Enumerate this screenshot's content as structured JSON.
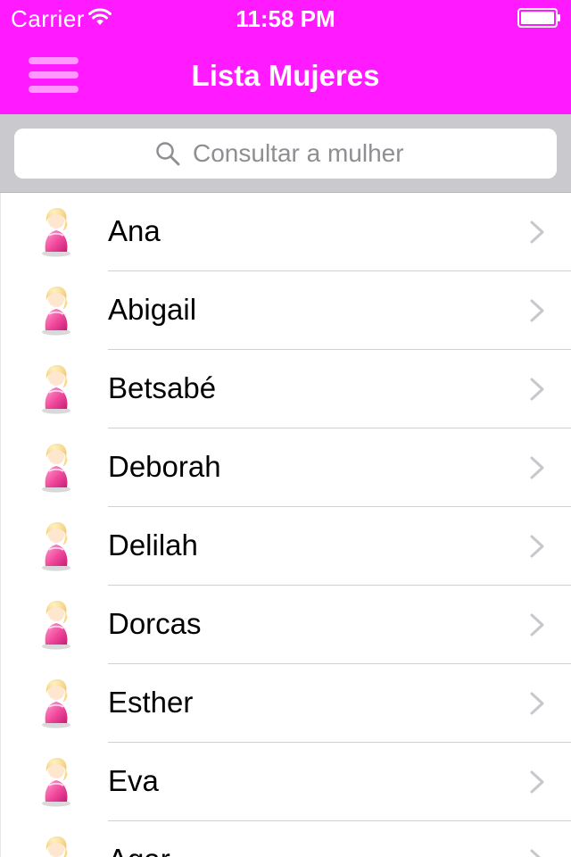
{
  "status_bar": {
    "carrier": "Carrier",
    "time": "11:58 PM",
    "wifi_icon": "wifi-icon",
    "battery_icon": "battery-icon"
  },
  "nav": {
    "title": "Lista Mujeres",
    "menu_icon": "hamburger-menu-icon",
    "background_color": "#ff1aff"
  },
  "search": {
    "placeholder": "Consultar a mulher",
    "value": "",
    "icon": "search-icon"
  },
  "list": {
    "item_icon": "woman-avatar-icon",
    "disclosure_icon": "chevron-right-icon",
    "items": [
      {
        "name": "Ana"
      },
      {
        "name": "Abigail"
      },
      {
        "name": "Betsabé"
      },
      {
        "name": "Deborah"
      },
      {
        "name": "Delilah"
      },
      {
        "name": "Dorcas"
      },
      {
        "name": "Esther"
      },
      {
        "name": "Eva"
      },
      {
        "name": "Agar"
      }
    ]
  }
}
